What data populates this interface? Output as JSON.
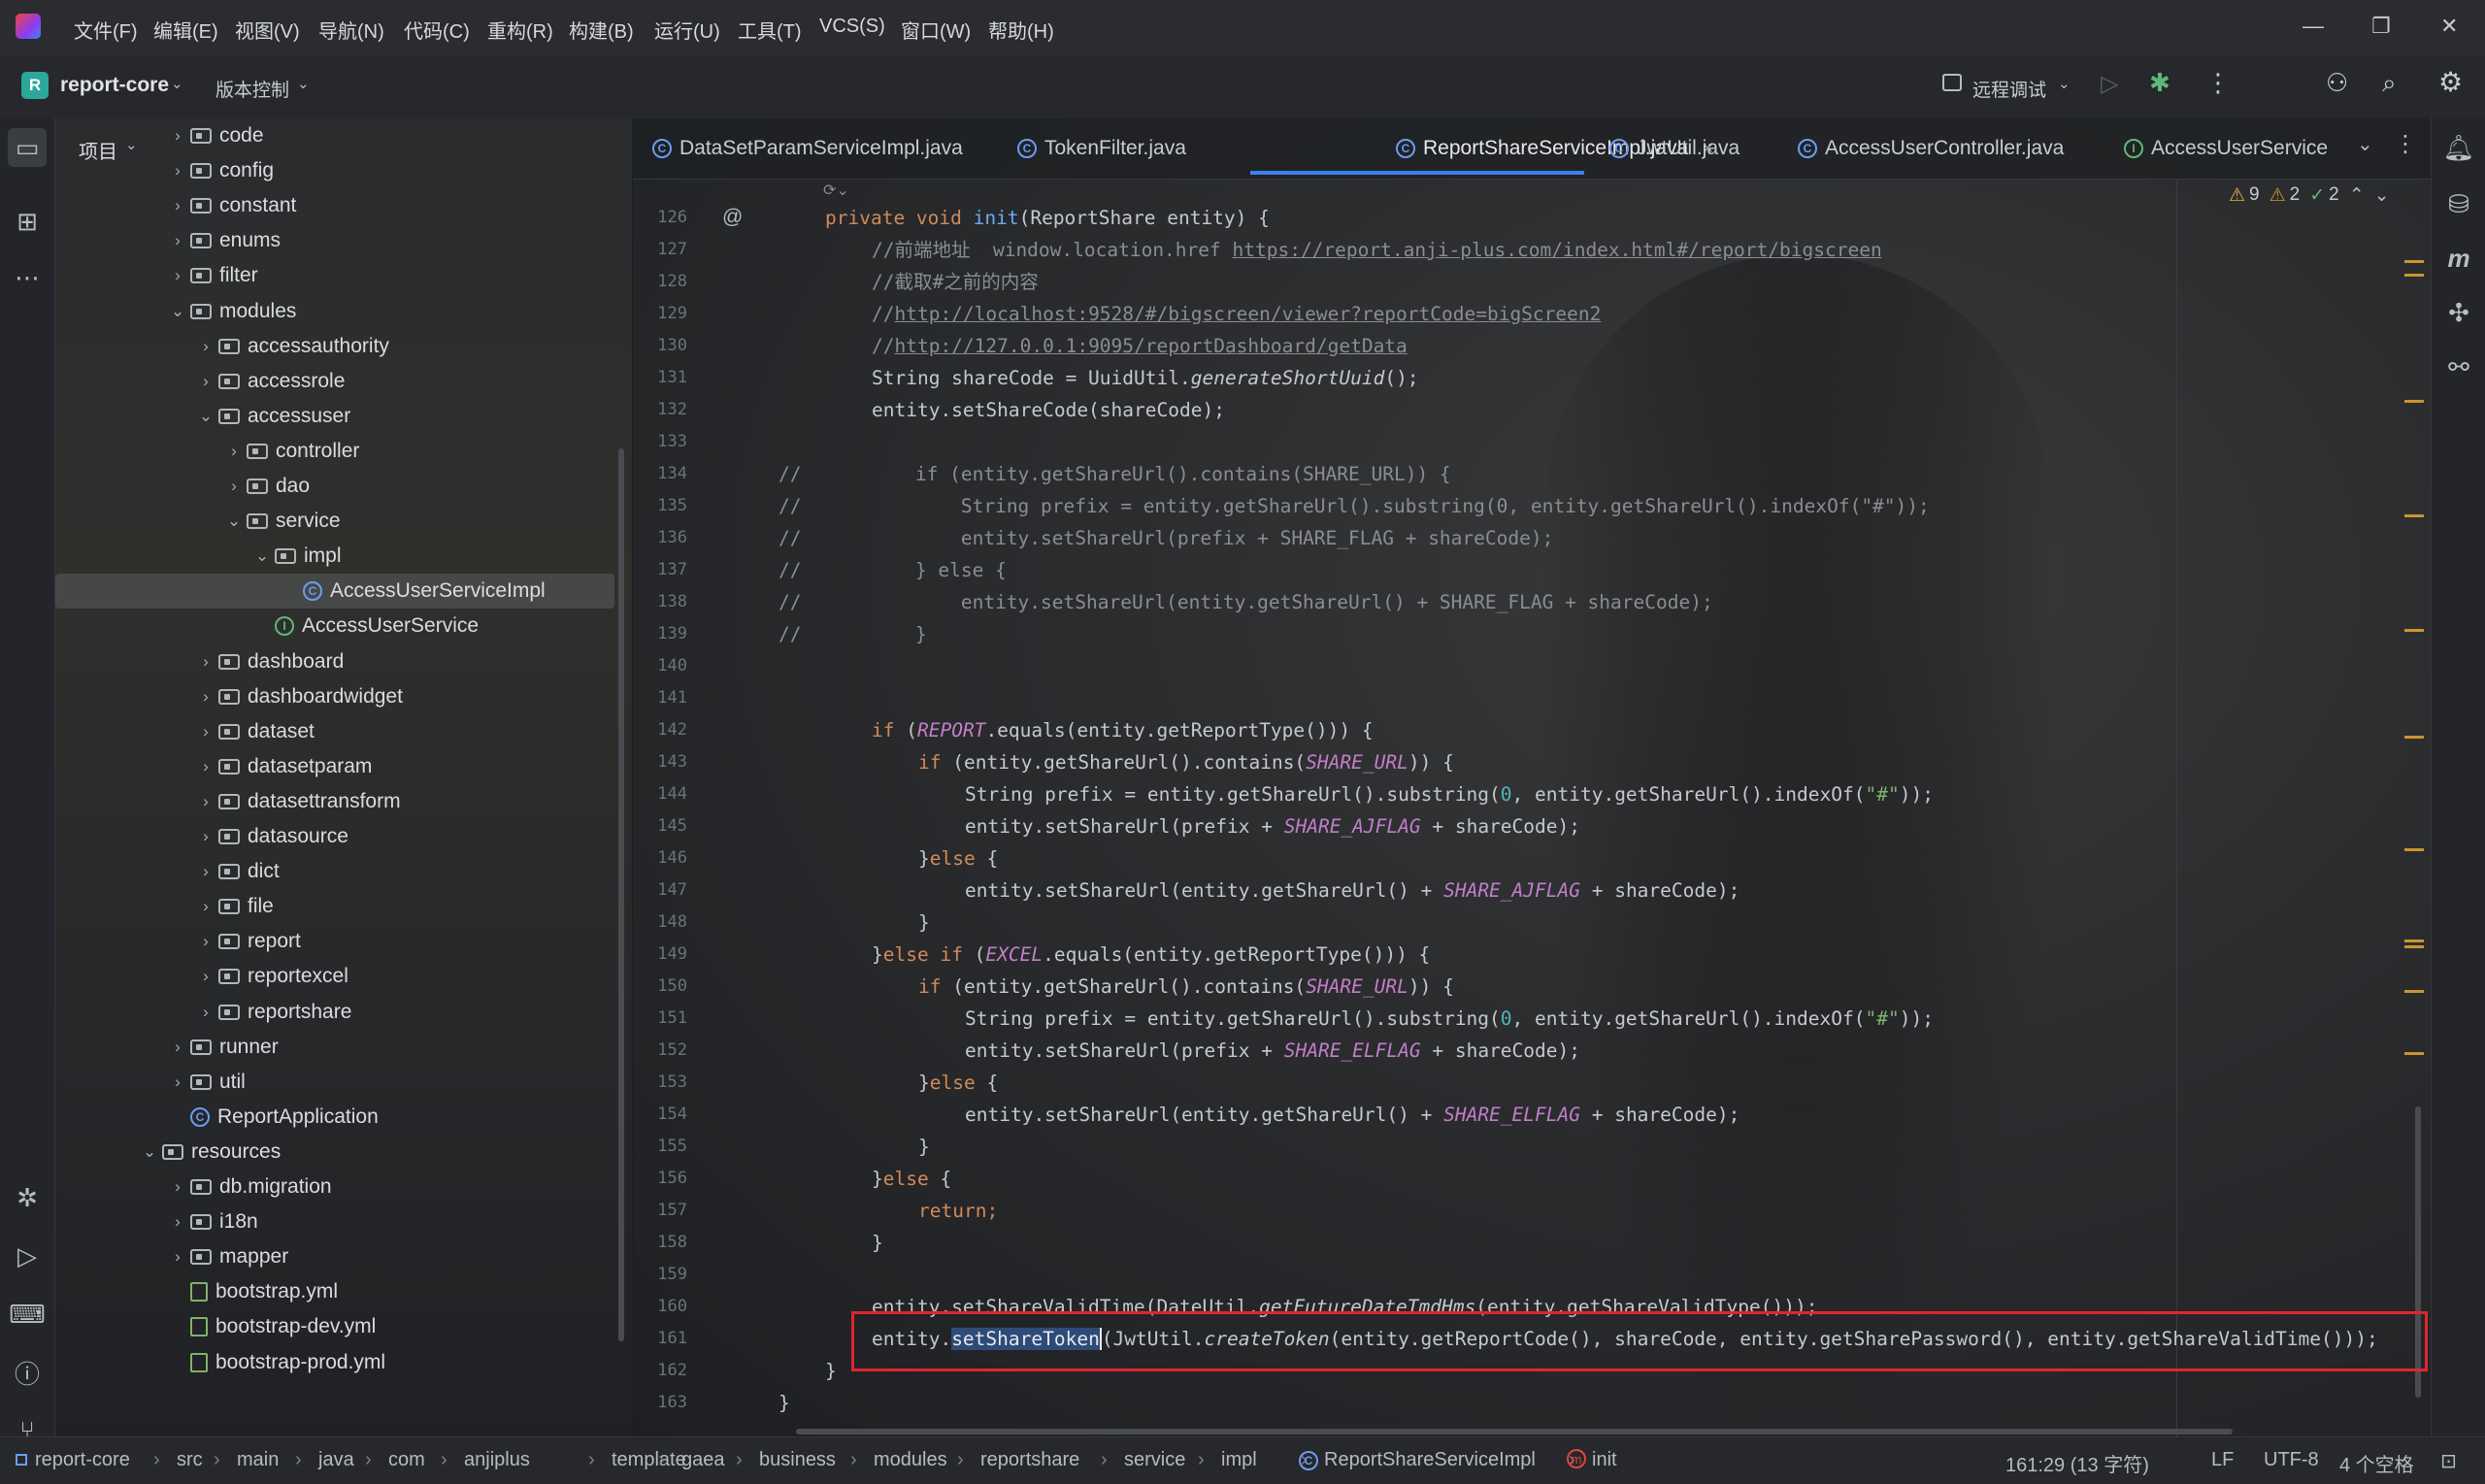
{
  "menu": [
    "文件(F)",
    "编辑(E)",
    "视图(V)",
    "导航(N)",
    "代码(C)",
    "重构(R)",
    "构建(B)",
    "运行(U)",
    "工具(T)",
    "VCS(S)",
    "窗口(W)",
    "帮助(H)"
  ],
  "project": {
    "badge": "R",
    "name": "report-core",
    "vcs": "版本控制",
    "run_config": "远程调试"
  },
  "panel": {
    "title": "项目"
  },
  "tree": [
    {
      "label": "code",
      "indent": 1,
      "type": "folder",
      "expanded": false
    },
    {
      "label": "config",
      "indent": 1,
      "type": "folder",
      "expanded": false
    },
    {
      "label": "constant",
      "indent": 1,
      "type": "folder",
      "expanded": false
    },
    {
      "label": "enums",
      "indent": 1,
      "type": "folder",
      "expanded": false
    },
    {
      "label": "filter",
      "indent": 1,
      "type": "folder",
      "expanded": false
    },
    {
      "label": "modules",
      "indent": 1,
      "type": "folder",
      "expanded": true
    },
    {
      "label": "accessauthority",
      "indent": 2,
      "type": "folder",
      "expanded": false
    },
    {
      "label": "accessrole",
      "indent": 2,
      "type": "folder",
      "expanded": false
    },
    {
      "label": "accessuser",
      "indent": 2,
      "type": "folder",
      "expanded": true
    },
    {
      "label": "controller",
      "indent": 3,
      "type": "folder",
      "expanded": false
    },
    {
      "label": "dao",
      "indent": 3,
      "type": "folder",
      "expanded": false
    },
    {
      "label": "service",
      "indent": 3,
      "type": "folder",
      "expanded": true
    },
    {
      "label": "impl",
      "indent": 4,
      "type": "folder",
      "expanded": true
    },
    {
      "label": "AccessUserServiceImpl",
      "indent": 5,
      "type": "class",
      "selected": true
    },
    {
      "label": "AccessUserService",
      "indent": 4,
      "type": "interface"
    },
    {
      "label": "dashboard",
      "indent": 2,
      "type": "folder",
      "expanded": false
    },
    {
      "label": "dashboardwidget",
      "indent": 2,
      "type": "folder",
      "expanded": false
    },
    {
      "label": "dataset",
      "indent": 2,
      "type": "folder",
      "expanded": false
    },
    {
      "label": "datasetparam",
      "indent": 2,
      "type": "folder",
      "expanded": false
    },
    {
      "label": "datasettransform",
      "indent": 2,
      "type": "folder",
      "expanded": false
    },
    {
      "label": "datasource",
      "indent": 2,
      "type": "folder",
      "expanded": false
    },
    {
      "label": "dict",
      "indent": 2,
      "type": "folder",
      "expanded": false
    },
    {
      "label": "file",
      "indent": 2,
      "type": "folder",
      "expanded": false
    },
    {
      "label": "report",
      "indent": 2,
      "type": "folder",
      "expanded": false
    },
    {
      "label": "reportexcel",
      "indent": 2,
      "type": "folder",
      "expanded": false
    },
    {
      "label": "reportshare",
      "indent": 2,
      "type": "folder",
      "expanded": false
    },
    {
      "label": "runner",
      "indent": 1,
      "type": "folder",
      "expanded": false
    },
    {
      "label": "util",
      "indent": 1,
      "type": "folder",
      "expanded": false
    },
    {
      "label": "ReportApplication",
      "indent": 1,
      "type": "class-leaf"
    },
    {
      "label": "resources",
      "indent": 0,
      "type": "folder",
      "expanded": true
    },
    {
      "label": "db.migration",
      "indent": 1,
      "type": "folder",
      "expanded": false
    },
    {
      "label": "i18n",
      "indent": 1,
      "type": "folder",
      "expanded": false
    },
    {
      "label": "mapper",
      "indent": 1,
      "type": "folder",
      "expanded": false
    },
    {
      "label": "bootstrap.yml",
      "indent": 1,
      "type": "file"
    },
    {
      "label": "bootstrap-dev.yml",
      "indent": 1,
      "type": "file"
    },
    {
      "label": "bootstrap-prod.yml",
      "indent": 1,
      "type": "file"
    }
  ],
  "tabs": [
    {
      "label": "DataSetParamServiceImpl.java",
      "kind": "class"
    },
    {
      "label": "TokenFilter.java",
      "kind": "class"
    },
    {
      "label": "ReportShareServiceImpl.java",
      "kind": "class",
      "active": true
    },
    {
      "label": "JwtUtil.java",
      "kind": "class"
    },
    {
      "label": "AccessUserController.java",
      "kind": "class"
    },
    {
      "label": "AccessUserService",
      "kind": "interface"
    }
  ],
  "inspections": {
    "warnings": "9",
    "weak_warnings": "2",
    "ok": "2"
  },
  "line_numbers": [
    "126",
    "127",
    "128",
    "129",
    "130",
    "131",
    "132",
    "133",
    "134",
    "135",
    "136",
    "137",
    "138",
    "139",
    "140",
    "141",
    "142",
    "143",
    "144",
    "145",
    "146",
    "147",
    "148",
    "149",
    "150",
    "151",
    "152",
    "153",
    "154",
    "155",
    "156",
    "157",
    "158",
    "159",
    "160",
    "161",
    "162",
    "163"
  ],
  "code": {
    "l126": "private void init(ReportShare entity) {",
    "l127_prefix": "//前端地址  window.location.href ",
    "l127_link": "https://report.anji-plus.com/index.html#/report/bigscreen",
    "l128": "//截取#之前的内容",
    "l129_link": "http://localhost:9528/#/bigscreen/viewer?reportCode=bigScreen2",
    "l130_link": "http://127.0.0.1:9095/reportDashboard/getData",
    "l131": "String shareCode = UuidUtil.generateShortUuid();",
    "l132": "entity.setShareCode(shareCode);",
    "l134": "    if (entity.getShareUrl().contains(SHARE_URL)) {",
    "l135": "        String prefix = entity.getShareUrl().substring(0, entity.getShareUrl().indexOf(\"#\"));",
    "l136": "        entity.setShareUrl(prefix + SHARE_FLAG + shareCode);",
    "l137": "    } else {",
    "l138": "        entity.setShareUrl(entity.getShareUrl() + SHARE_FLAG + shareCode);",
    "l139": "    }",
    "l142": "if (REPORT.equals(entity.getReportType())) {",
    "l143": "if (entity.getShareUrl().contains(SHARE_URL)) {",
    "l144": "String prefix = entity.getShareUrl().substring(0, entity.getShareUrl().indexOf(\"#\"));",
    "l145": "entity.setShareUrl(prefix + SHARE_AJFLAG + shareCode);",
    "l146": "}else {",
    "l147": "entity.setShareUrl(entity.getShareUrl() + SHARE_AJFLAG + shareCode);",
    "l148": "}",
    "l149": "}else if (EXCEL.equals(entity.getReportType())) {",
    "l150": "if (entity.getShareUrl().contains(SHARE_URL)) {",
    "l151": "String prefix = entity.getShareUrl().substring(0, entity.getShareUrl().indexOf(\"#\"));",
    "l152": "entity.setShareUrl(prefix + SHARE_ELFLAG + shareCode);",
    "l153": "}else {",
    "l154": "entity.setShareUrl(entity.getShareUrl() + SHARE_ELFLAG + shareCode);",
    "l155": "}",
    "l156": "}else {",
    "l157": "return;",
    "l158": "}",
    "l160": "entity.setShareValidTime(DateUtil.getFutureDateTmdHms(entity.getShareValidType()));",
    "l161_a": "entity.",
    "l161_sel": "setShareToken",
    "l161_b": "(JwtUtil.createToken(entity.getReportCode(), shareCode, entity.getSharePassword(), entity.getShareValidTime()));",
    "l162": "}",
    "l163": "}"
  },
  "breadcrumb": [
    "report-core",
    "src",
    "main",
    "java",
    "com",
    "anjiplus",
    "template",
    "gaea",
    "business",
    "modules",
    "reportshare",
    "service",
    "impl",
    "ReportShareServiceImpl",
    "init"
  ],
  "status": {
    "position": "161:29 (13 字符)",
    "line_sep": "LF",
    "encoding": "UTF-8",
    "indent": "4 个空格"
  }
}
